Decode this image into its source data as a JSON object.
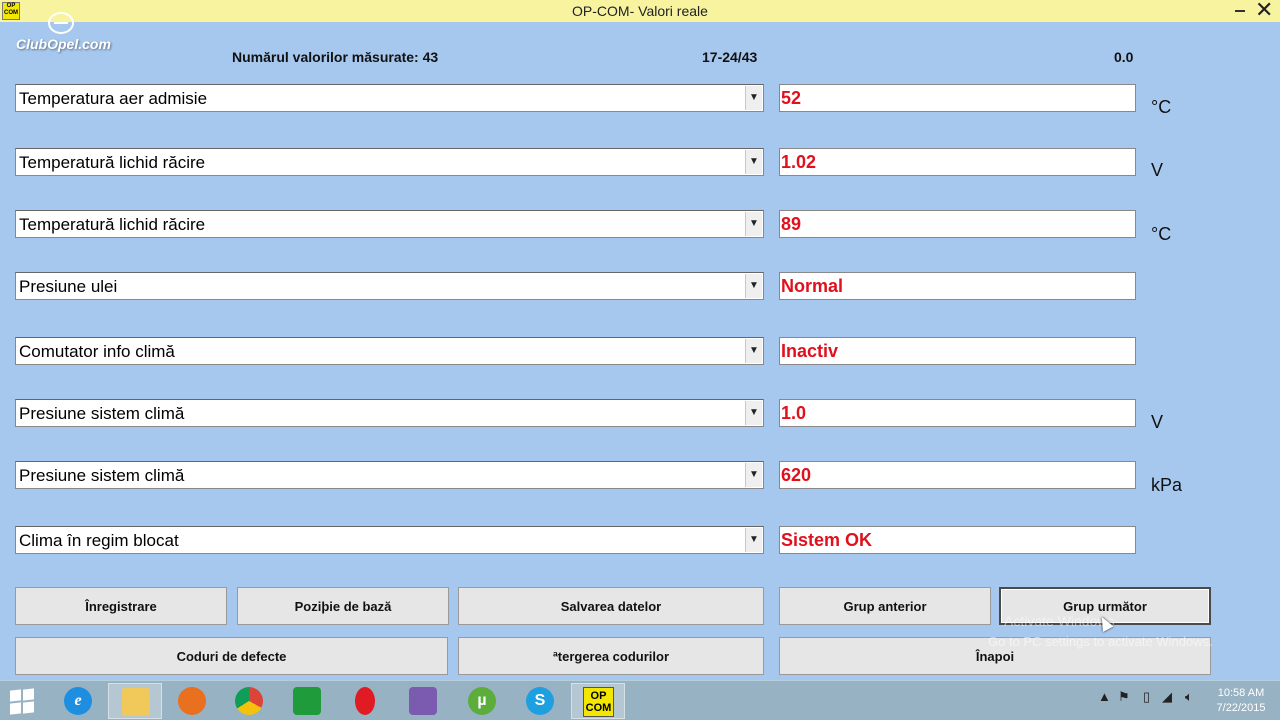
{
  "window": {
    "title": "OP-COM- Valori reale",
    "icon_text": "OP COM",
    "close_glyph": "✕"
  },
  "watermark": {
    "text": "ClubOpel.com"
  },
  "header": {
    "count_label": "Numărul valorilor măsurate: 43",
    "range_label": "17-24/43",
    "value_label": "0.0"
  },
  "rows": [
    {
      "param": "Temperatura aer admisie",
      "value": "52",
      "unit": "°C"
    },
    {
      "param": "Temperatură lichid răcire",
      "value": "1.02",
      "unit": "V"
    },
    {
      "param": "Temperatură lichid răcire",
      "value": "89",
      "unit": "°C"
    },
    {
      "param": "Presiune ulei",
      "value": "Normal",
      "unit": ""
    },
    {
      "param": "Comutator info climă",
      "value": "Inactiv",
      "unit": ""
    },
    {
      "param": "Presiune sistem climă",
      "value": "1.0",
      "unit": "V"
    },
    {
      "param": "Presiune sistem climă",
      "value": "620",
      "unit": "kPa"
    },
    {
      "param": "Clima în regim blocat",
      "value": "Sistem OK",
      "unit": ""
    }
  ],
  "buttons": {
    "record": "Înregistrare",
    "base_position": "Poziþie de bază",
    "save_data": "Salvarea datelor",
    "prev_group": "Grup anterior",
    "next_group": "Grup următor",
    "fault_codes": "Coduri de defecte",
    "clear_codes": "ªtergerea codurilor",
    "back": "Înapoi"
  },
  "activation": {
    "heading": "Activate Windows",
    "notice": "Go to PC settings to activate Windows."
  },
  "taskbar": {
    "opcom_label_line1": "OP",
    "opcom_label_line2": "COM",
    "time": "10:58 AM",
    "date": "7/22/2015"
  },
  "colors": {
    "value_text": "#e0101c",
    "background": "#a7c8ee",
    "titlebar": "#f7f39e"
  }
}
